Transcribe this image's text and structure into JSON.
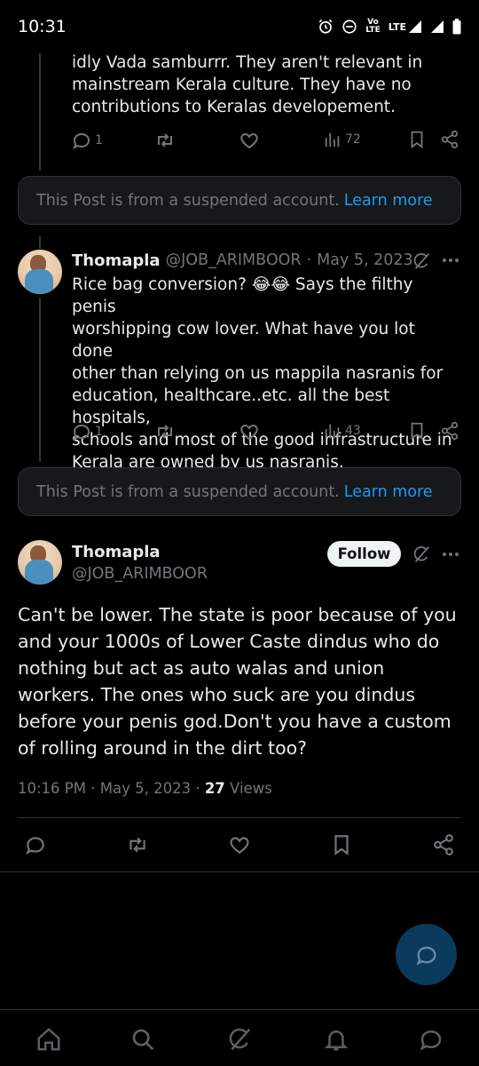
{
  "status_bar": {
    "time": "10:31",
    "icons": [
      "alarm-icon",
      "dnd-icon",
      "volte-icon",
      "lte-icon",
      "signal-icon",
      "signal-icon",
      "battery-icon"
    ],
    "volte_label": "Vo\nLTE",
    "lte_label": "LTE"
  },
  "tweet1": {
    "text_partial": "idly Vada samburrr. They aren't relevant in\nmainstream Kerala culture. They have no\ncontributions to Keralas developement.",
    "replies": "1",
    "views": "72"
  },
  "suspended1": {
    "text": "This Post is from a suspended account.",
    "link": "Learn more"
  },
  "tweet2": {
    "name": "Thomapla",
    "handle": "@JOB_ARIMBOOR",
    "separator": "·",
    "date": "May 5, 2023",
    "text": "Rice bag conversion? 😂😂 Says the filthy penis\nworshipping cow lover. What have you lot done\nother than relying on us mappila nasranis for\neducation, healthcare..etc. all the best hospitals,\nschools and most of the good infrastructure in\nKerala are owned by us nasranis.",
    "replies": "1",
    "views": "43"
  },
  "suspended2": {
    "text": "This Post is from a suspended account.",
    "link": "Learn more"
  },
  "main_tweet": {
    "name": "Thomapla",
    "handle": "@JOB_ARIMBOOR",
    "follow_label": "Follow",
    "text": "Can't be lower. The state is poor because of you and your 1000s of Lower Caste dindus who do nothing but act as auto walas and union workers. The ones who suck are you dindus before your penis god.Don't you have a custom of rolling around in the dirt too?",
    "time": "10:16 PM",
    "separator": "·",
    "date": "May 5, 2023",
    "views_count": "27",
    "views_label": "Views"
  },
  "bottom_nav": [
    "home-icon",
    "search-icon",
    "grok-icon",
    "notifications-icon",
    "messages-icon"
  ],
  "colors": {
    "background": "#000000",
    "text": "#e7e9ea",
    "secondary": "#71767b",
    "link": "#1d9bf0",
    "card": "#16181c",
    "border": "#2f3336"
  }
}
